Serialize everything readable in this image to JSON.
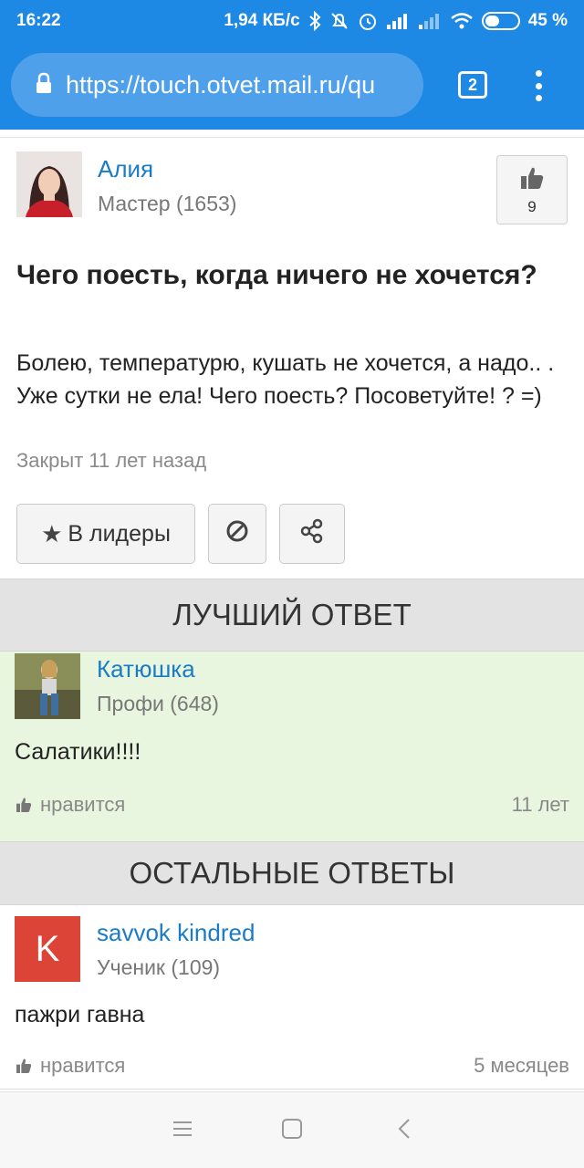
{
  "status_bar": {
    "time": "16:22",
    "network_speed": "1,94 КБ/с",
    "battery_percent": "45 %",
    "battery_level": 0.45
  },
  "browser": {
    "url": "https://touch.otvet.mail.ru/qu",
    "tab_count": "2"
  },
  "question": {
    "author_name": "Алия",
    "author_rank": "Мастер (1653)",
    "like_count": "9",
    "title": "Чего поесть, когда ничего не хочется?",
    "body": "Болею, температурю, кушать не хочется, а надо.. . Уже сутки не ела! Чего поесть? Посоветуйте! ? =)",
    "status": "Закрыт 11 лет назад",
    "leaders_button": "В лидеры"
  },
  "best_answer": {
    "section_title": "ЛУЧШИЙ ОТВЕТ",
    "author_name": "Катюшка",
    "author_rank": "Профи (648)",
    "text": "Салатики!!!!",
    "like_label": "нравится",
    "ago": "11 лет"
  },
  "other_answers": {
    "section_title": "ОСТАЛЬНЫЕ ОТВЕТЫ",
    "items": [
      {
        "avatar_letter": "K",
        "author_name": "savvok kindred",
        "author_rank": "Ученик (109)",
        "text": "пажри гавна",
        "like_label": "нравится",
        "ago": "5 месяцев"
      }
    ]
  },
  "icons": {
    "like": "thumbs-up-icon",
    "block": "block-icon",
    "share": "share-icon",
    "star": "star-icon"
  },
  "colors": {
    "accent": "#1e88e5",
    "link": "#1a7bc6",
    "best_answer_bg": "#e8f6df",
    "avatar_k": "#db4437"
  }
}
